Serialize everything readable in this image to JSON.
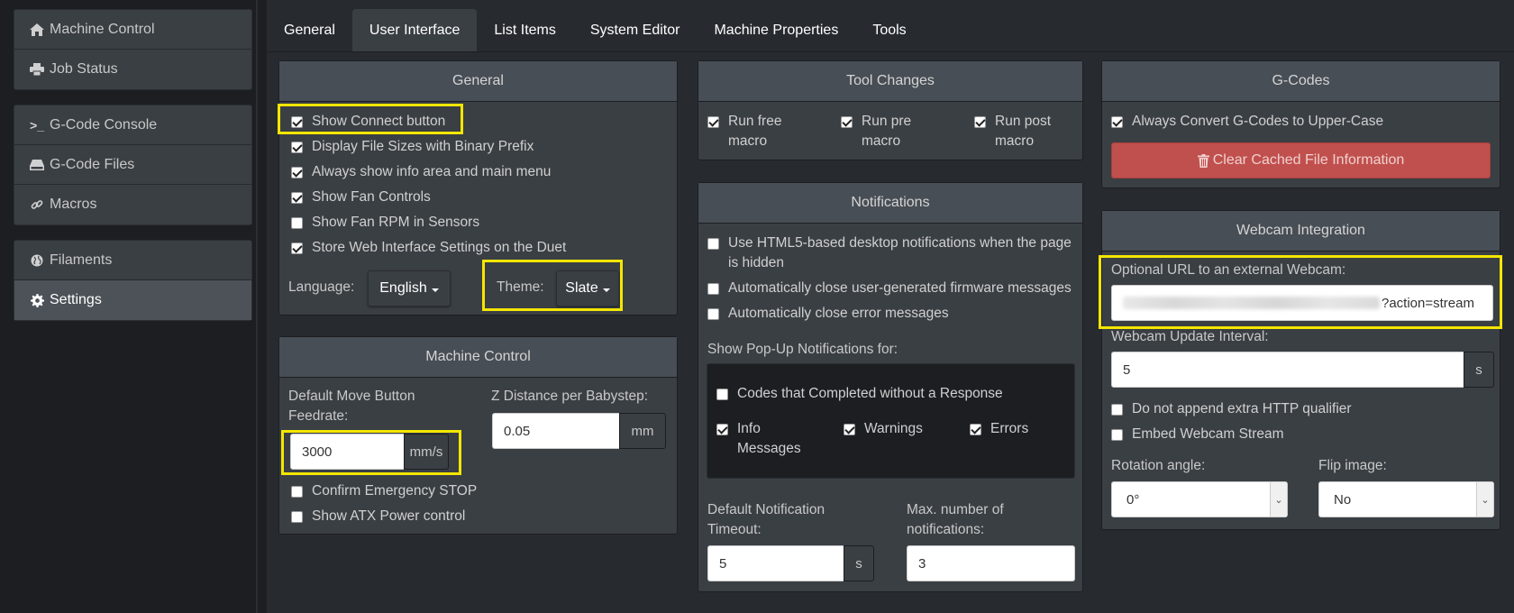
{
  "sidebar": {
    "group1": [
      {
        "label": "Machine Control",
        "icon": "home-icon"
      },
      {
        "label": "Job Status",
        "icon": "printer-icon"
      }
    ],
    "group2": [
      {
        "label": "G-Code Console",
        "icon": "terminal-icon"
      },
      {
        "label": "G-Code Files",
        "icon": "hdd-icon"
      },
      {
        "label": "Macros",
        "icon": "link-icon"
      }
    ],
    "group3": [
      {
        "label": "Filaments",
        "icon": "globe-icon"
      },
      {
        "label": "Settings",
        "icon": "gear-icon",
        "active": true
      }
    ]
  },
  "tabs": [
    "General",
    "User Interface",
    "List Items",
    "System Editor",
    "Machine Properties",
    "Tools"
  ],
  "active_tab": "User Interface",
  "general_panel": {
    "title": "General",
    "checkboxes": [
      {
        "label": "Show Connect button",
        "checked": true
      },
      {
        "label": "Display File Sizes with Binary Prefix",
        "checked": true
      },
      {
        "label": "Always show info area and main menu",
        "checked": true
      },
      {
        "label": "Show Fan Controls",
        "checked": true
      },
      {
        "label": "Show Fan RPM in Sensors",
        "checked": false
      },
      {
        "label": "Store Web Interface Settings on the Duet",
        "checked": true
      }
    ],
    "language_label": "Language:",
    "language_value": "English",
    "theme_label": "Theme:",
    "theme_value": "Slate"
  },
  "machine_control_panel": {
    "title": "Machine Control",
    "feedrate_label_1": "Default Move Button",
    "feedrate_label_2": "Feedrate:",
    "feedrate_value": "3000",
    "feedrate_unit": "mm/s",
    "babystep_label": "Z Distance per Babystep:",
    "babystep_value": "0.05",
    "babystep_unit": "mm",
    "checkboxes": [
      {
        "label": "Confirm Emergency STOP",
        "checked": false
      },
      {
        "label": "Show ATX Power control",
        "checked": false
      }
    ]
  },
  "tool_changes_panel": {
    "title": "Tool Changes",
    "checkboxes": [
      {
        "line1": "Run free",
        "line2": "macro",
        "checked": true
      },
      {
        "line1": "Run pre",
        "line2": "macro",
        "checked": true
      },
      {
        "line1": "Run post",
        "line2": "macro",
        "checked": true
      }
    ]
  },
  "notifications_panel": {
    "title": "Notifications",
    "html5_line1": "Use HTML5-based desktop notifications when the page",
    "html5_line2": "is hidden",
    "html5_checked": false,
    "auto_close_firmware": "Automatically close user-generated firmware messages",
    "auto_close_errors": "Automatically close error messages",
    "popup_header": "Show Pop-Up Notifications for:",
    "codes_no_response": "Codes that Completed without a Response",
    "info_line1": "Info",
    "info_line2": "Messages",
    "warnings": "Warnings",
    "errors": "Errors",
    "timeout_label_1": "Default Notification",
    "timeout_label_2": "Timeout:",
    "timeout_value": "5",
    "timeout_unit": "s",
    "max_label_1": "Max. number of",
    "max_label_2": "notifications:",
    "max_value": "3"
  },
  "gcodes_panel": {
    "title": "G-Codes",
    "uppercase_label": "Always Convert G-Codes to Upper-Case",
    "uppercase_checked": true,
    "clear_cache_label": "Clear Cached File Information"
  },
  "webcam_panel": {
    "title": "Webcam Integration",
    "url_label": "Optional URL to an external Webcam:",
    "url_value_visible": "?action=stream",
    "interval_label": "Webcam Update Interval:",
    "interval_value": "5",
    "interval_unit": "s",
    "no_http_qualifier": "Do not append extra HTTP qualifier",
    "embed_stream": "Embed Webcam Stream",
    "rotation_label": "Rotation angle:",
    "rotation_value": "0°",
    "flip_label": "Flip image:",
    "flip_value": "No"
  },
  "colors": {
    "highlight": "#f4e600",
    "panel_bg": "#3a3f44",
    "danger": "#c0504d"
  }
}
